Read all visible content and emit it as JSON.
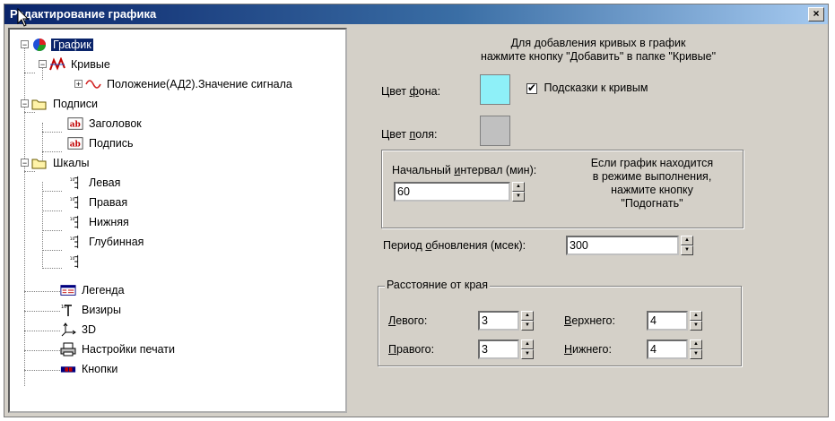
{
  "window": {
    "title": "Редактирование графика",
    "close_label": "×"
  },
  "tree": {
    "root": "График",
    "curves": "Кривые",
    "curve_item": "Положение(АД2).Значение сигнала",
    "captions": "Подписи",
    "caption_title": "Заголовок",
    "caption_sign": "Подпись",
    "scales": "Шкалы",
    "scale_left": "Левая",
    "scale_right": "Правая",
    "scale_bottom": "Нижняя",
    "scale_depth": "Глубинная",
    "legend": "Легенда",
    "sights": "Визиры",
    "three_d": "3D",
    "print": "Настройки печати",
    "buttons": "Кнопки"
  },
  "panel": {
    "hint_line1": "Для добавления кривых в график",
    "hint_line2": "нажмите кнопку \"Добавить\" в папке \"Кривые\"",
    "bg_color_label_pre": "Цвет ",
    "bg_color_label_u": "ф",
    "bg_color_label_post": "она:",
    "bg_color": "#8ef0f8",
    "curve_hints_checkbox": "Подсказки к кривым",
    "field_color_label_pre": "Цвет ",
    "field_color_label_u": "п",
    "field_color_label_post": "оля:",
    "field_color": "#c0c0c0",
    "interval_label_pre": "Начальный ",
    "interval_label_u": "и",
    "interval_label_post": "нтервал (мин):",
    "interval_value": "60",
    "interval_note": [
      "Если график находится",
      "в режиме выполнения,",
      "нажмите кнопку",
      "\"Подогнать\""
    ],
    "period_label_pre": "Период ",
    "period_label_u": "о",
    "period_label_post": "бновления (мсек):",
    "period_value": "300",
    "margins_legend": "Расстояние от края",
    "left_u": "Л",
    "left_rest": "евого:",
    "left_value": "3",
    "right_u": "П",
    "right_rest": "равого:",
    "right_value": "3",
    "top_u": "В",
    "top_rest": "ерхнего:",
    "top_value": "4",
    "bottom_u": "Н",
    "bottom_rest": "ижнего:",
    "bottom_value": "4"
  }
}
